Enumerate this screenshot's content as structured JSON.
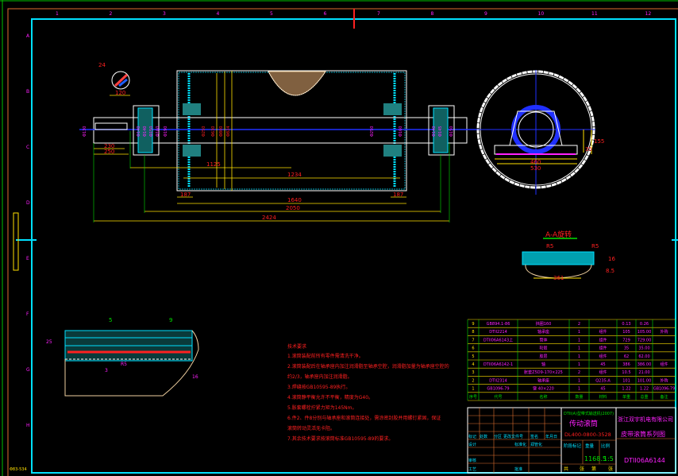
{
  "border": {
    "columns": [
      "1",
      "2",
      "3",
      "4",
      "5",
      "6",
      "7",
      "8",
      "9",
      "10",
      "11",
      "12"
    ],
    "rows": [
      "A",
      "B",
      "C",
      "D",
      "E",
      "F",
      "G",
      "H"
    ],
    "corner_label": "Φ83-534"
  },
  "main_view": {
    "dims_horizontal": {
      "overall": "2424",
      "bearing_span": "2050",
      "drum_length": "1640",
      "hub_span": "1234",
      "shaft_left": "1125",
      "hub_left": "187",
      "hub_right": "187",
      "key_len": "230",
      "shaft_end": "250",
      "key_section_width": "120",
      "key_depth": "24"
    },
    "dims_vertical_left": [
      "Φ130",
      "Φ140",
      "Φ140",
      "Φ150",
      "Φ160",
      "Φ190"
    ],
    "dims_vertical_center": [
      "Φ250",
      "Φ630",
      "Φ800",
      "Φ824"
    ],
    "dims_vertical_right": [
      "Φ250",
      "Φ160",
      "Φ140",
      "Φ145",
      "Φ150"
    ]
  },
  "end_view": {
    "dims": [
      "460",
      "530",
      "155",
      "35"
    ]
  },
  "section_view": {
    "title": "A-A旋转",
    "dims": [
      "R5",
      "R5",
      "16",
      "8.5",
      "361"
    ]
  },
  "detail_view": {
    "balloons": [
      "5",
      "9"
    ],
    "dims": [
      "25",
      "3",
      "16",
      "R5"
    ]
  },
  "notes": {
    "title": "技术要求",
    "lines": [
      "1.滚筒装配前所有零件需清洗干净。",
      "2.滚筒装配后在轴承座内加注润滑脂至轴承空腔，润滑脂加量为轴承座空腔的",
      "约2/3，轴承座内加注润滑脂。",
      "3.焊缝按GB10595-89执行。",
      "4.滚筒静平衡允许不平衡，精度为G40。",
      "5.胀套螺栓拧紧力矩为145Nm。",
      "6.件2、件8分别与轴承座和滚筒连接处，需涂密封胶并用螺钉紧固，保证",
      "滚筒转动灵活无卡阻。",
      "7.其余技术要求按滚筒标准GB10595-89的要求。"
    ]
  },
  "parts_table": {
    "headers": [
      "序号",
      "代号",
      "名称",
      "数量",
      "材料",
      "单重",
      "总重",
      "备注"
    ],
    "rows": [
      [
        "9",
        "GB894.1-86",
        "挡圈160",
        "2",
        "",
        "0.13",
        "0.26",
        ""
      ],
      [
        "8",
        "DTII2214",
        "轴承座",
        "1",
        "组件",
        "105",
        "105.00",
        "外购"
      ],
      [
        "7",
        "DTII06A6143上",
        "筒体",
        "1",
        "组件",
        "729",
        "729.00",
        ""
      ],
      [
        "6",
        "",
        "轮毂",
        "1",
        "组件",
        "35",
        "35.00",
        ""
      ],
      [
        "5",
        "",
        "胶层",
        "1",
        "组件",
        "62",
        "62.00",
        ""
      ],
      [
        "4",
        "DTII06A6142-1",
        "轴",
        "1",
        "45",
        "386",
        "386.00",
        "组件"
      ],
      [
        "3",
        "",
        "胀套Z5D9-170×225",
        "2",
        "组件",
        "10.5",
        "21.00",
        ""
      ],
      [
        "2",
        "DTII2314",
        "轴承座",
        "1",
        "Q235-A",
        "101",
        "101.00",
        "外购"
      ],
      [
        "1",
        "GB1096-79",
        "键 40×220",
        "1",
        "45",
        "1.22",
        "1.22",
        "GB1096-79"
      ]
    ]
  },
  "title_block": {
    "standard": "DTII(A)型带式输送机(2007)",
    "drawing_name": "传动滚筒",
    "spec": "DL400-0800-3528",
    "company": "浙江双宇机电有限公司",
    "series": "皮带滚筒系列图",
    "drawing_no": "DTII06A6144",
    "weight_scale": "1168.5",
    "scale": "1:5",
    "labels": {
      "rev": "标记",
      "count": "处数",
      "zone": "分区",
      "change": "更改文件号",
      "sign": "签名",
      "date": "年月日",
      "design": "设计",
      "standardize": "标准化",
      "check": "审核",
      "process": "工艺",
      "approve": "批准",
      "stage": "阶段标记",
      "weight": "重量",
      "ratio": "比例",
      "total": "共",
      "sheets": "张",
      "sheet": "第",
      "sheets2": "张",
      "person": "郑管化"
    }
  }
}
